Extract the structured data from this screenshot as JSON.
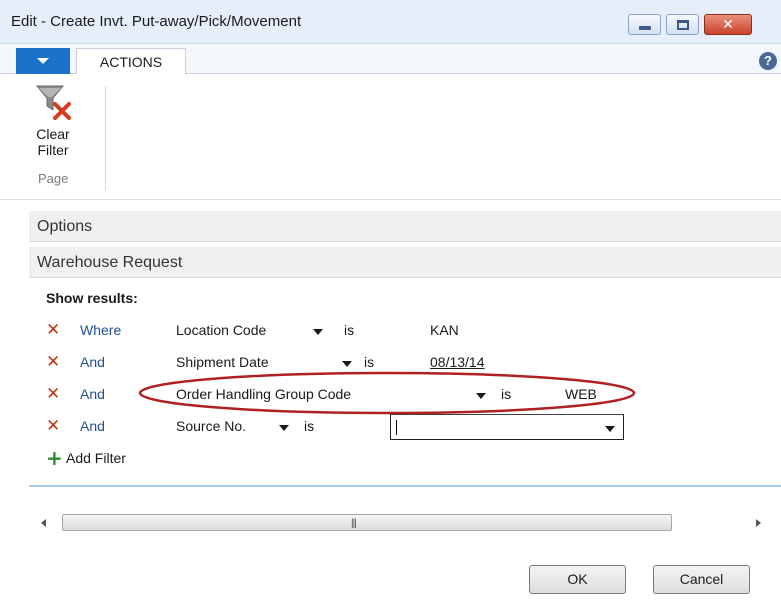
{
  "window": {
    "title": "Edit - Create Invt. Put-away/Pick/Movement",
    "close_glyph": "✕"
  },
  "ribbon": {
    "tabs": [
      {
        "label": "ACTIONS"
      }
    ],
    "clear_filter_label_1": "Clear",
    "clear_filter_label_2": "Filter",
    "group_label": "Page",
    "help_glyph": "?"
  },
  "sections": {
    "options": "Options",
    "warehouse_request": "Warehouse Request"
  },
  "filters": {
    "heading": "Show results:",
    "rows": [
      {
        "conjunction": "Where",
        "field": "Location Code",
        "operator": "is",
        "value": "KAN"
      },
      {
        "conjunction": "And",
        "field": "Shipment Date",
        "operator": "is",
        "value": "08/13/14"
      },
      {
        "conjunction": "And",
        "field": "Order Handling Group Code",
        "operator": "is",
        "value": "WEB"
      },
      {
        "conjunction": "And",
        "field": "Source No.",
        "operator": "is",
        "value": ""
      }
    ],
    "add_filter_label": "Add Filter",
    "remove_glyph": "✕",
    "add_glyph": "+"
  },
  "scrollbar": {
    "grip": "|||"
  },
  "buttons": {
    "ok": "OK",
    "cancel": "Cancel"
  },
  "colors": {
    "accent_blue": "#1a72c9",
    "remove_red": "#c1361b",
    "highlight_ellipse": "#b02020",
    "link_blue": "#1f4f9a",
    "add_green": "#2e8b2e"
  }
}
